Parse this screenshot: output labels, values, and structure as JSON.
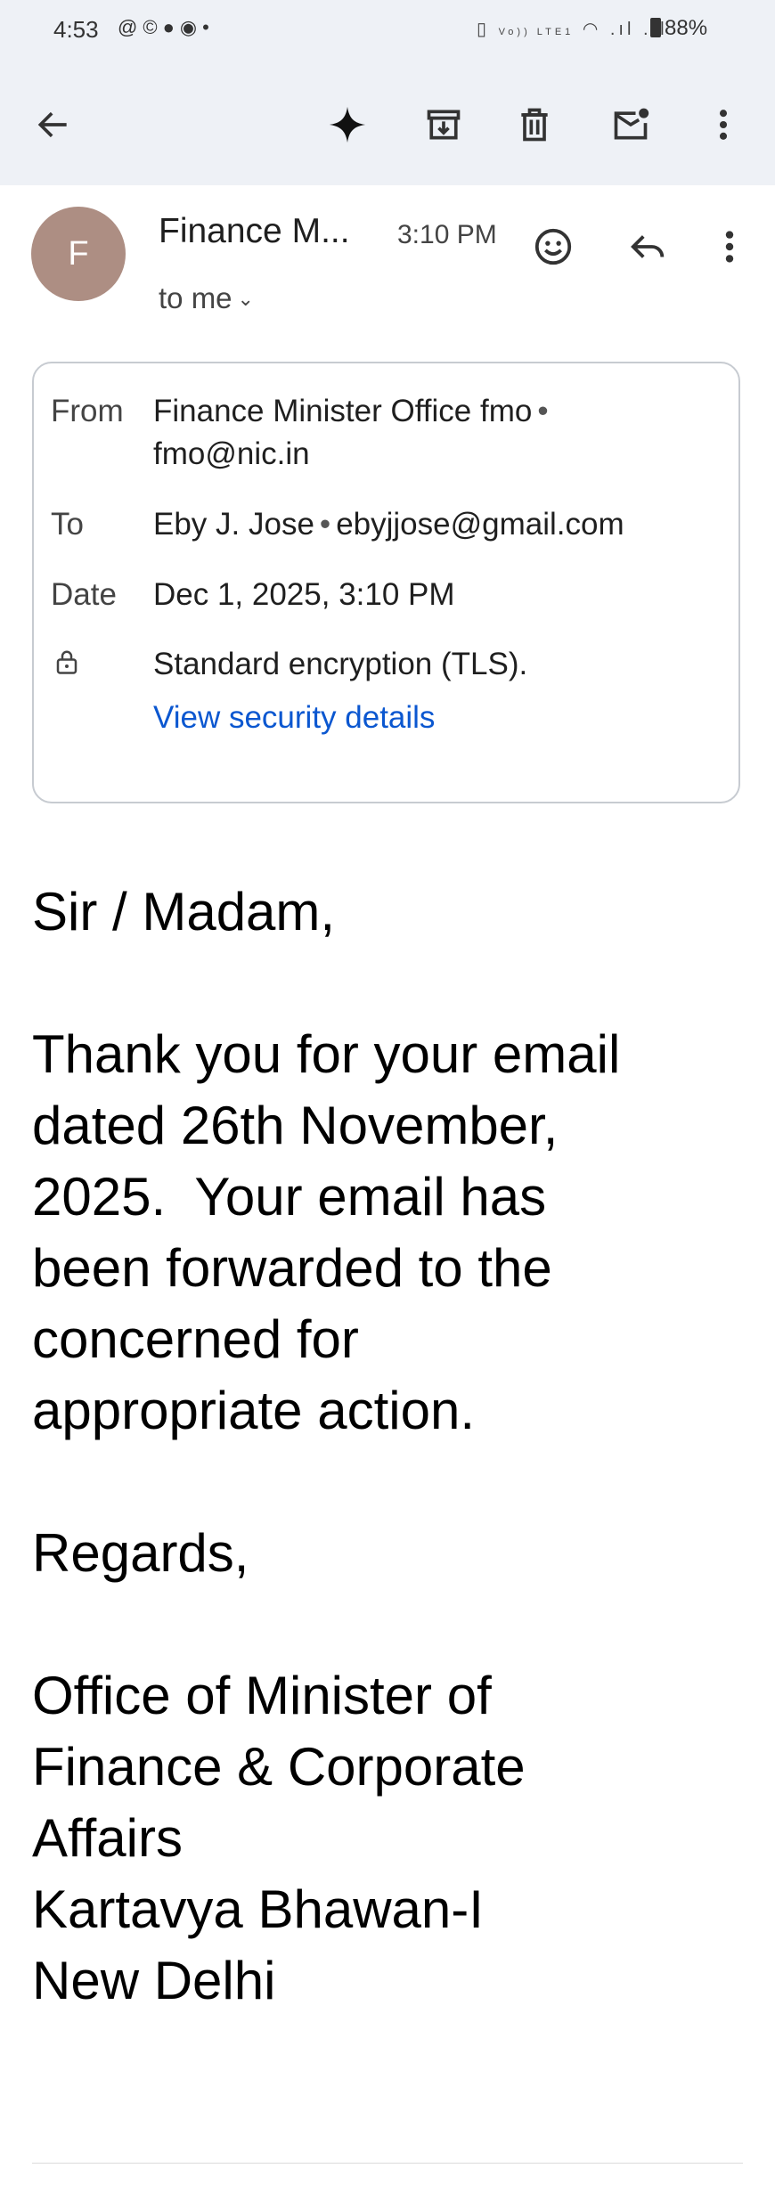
{
  "status_bar": {
    "time": "4:53",
    "notification_icons": [
      "threads-icon",
      "whatsapp-icon",
      "chat-icon",
      "messenger-icon",
      "dot-icon"
    ],
    "system_icons_text": "Vo)) LTE1",
    "battery": "88%"
  },
  "toolbar": {
    "icons": [
      "back-arrow-icon",
      "gemini-sparkle-icon",
      "archive-icon",
      "delete-icon",
      "mark-unread-icon",
      "more-vert-icon"
    ]
  },
  "email": {
    "sender_short": "Finance M...",
    "avatar_letter": "F",
    "time": "3:10 PM",
    "to_me": "to me",
    "details": {
      "from_label": "From",
      "from_name": "Finance Minister Office fmo",
      "from_email": "fmo@nic.in",
      "to_label": "To",
      "to_name": "Eby J. Jose",
      "to_email": "ebyjjose@gmail.com",
      "date_label": "Date",
      "date_value": "Dec 1, 2025, 3:10 PM",
      "encryption": "Standard encryption (TLS).",
      "security_link": "View security details"
    },
    "body_lines": [
      "Sir / Madam,",
      "Thank you for your email",
      "dated 26th November,",
      "2025.  Your email has",
      "been forwarded to the",
      "concerned for",
      "appropriate action.",
      "Regards,",
      "Office of Minister of",
      "Finance & Corporate",
      "Affairs",
      "Kartavya Bhawan-I",
      "New Delhi"
    ]
  },
  "colors": {
    "toolbar_bg": "#eef1f6",
    "avatar_bg": "#ad8e83",
    "link": "#0b57d0"
  }
}
